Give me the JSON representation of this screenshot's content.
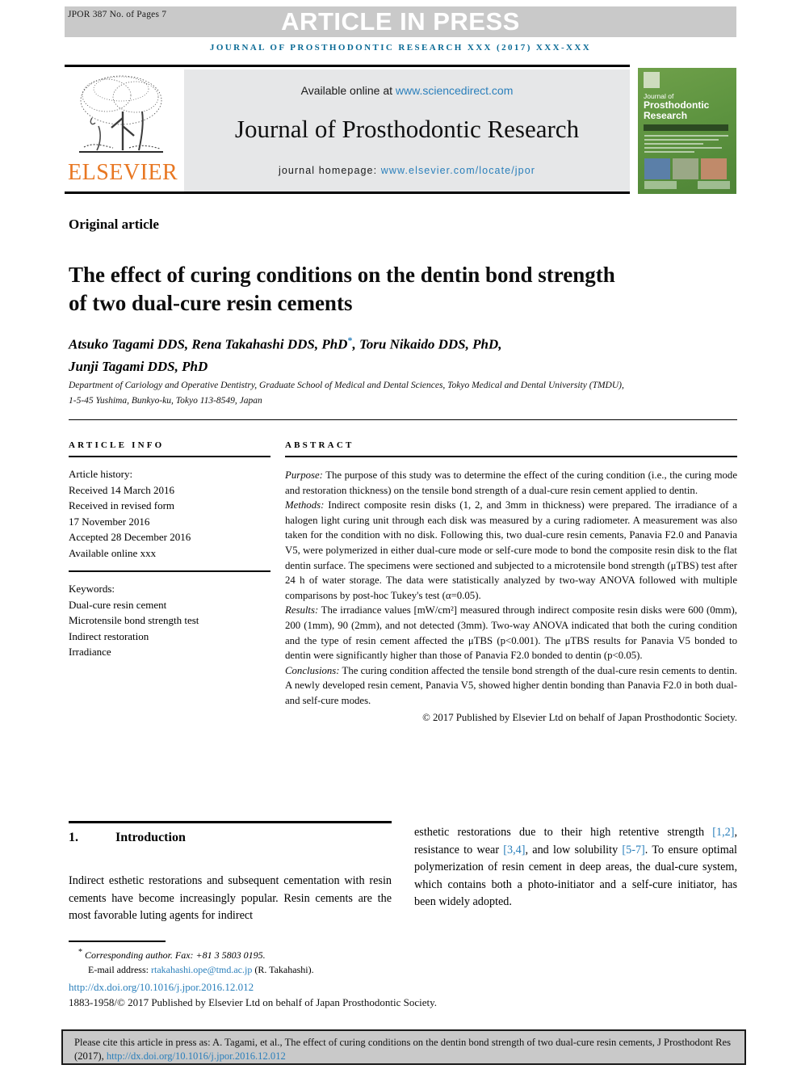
{
  "banner": {
    "jpor_code": "JPOR 387 No. of Pages 7",
    "article_in_press": "ARTICLE IN PRESS",
    "running_head": "JOURNAL OF PROSTHODONTIC RESEARCH XXX (2017) XXX-XXX",
    "accent_color": "#0a6a95",
    "banner_color": "#c9c9c9"
  },
  "masthead": {
    "available_prefix": "Available online at ",
    "sciencedirect_url": "www.sciencedirect.com",
    "journal_title": "Journal of Prosthodontic Research",
    "homepage_prefix": "journal homepage: ",
    "homepage_url": "www.elsevier.com/locate/jpor",
    "publisher": "ELSEVIER",
    "publisher_color": "#e87722",
    "link_color": "#2a7fbb",
    "cover": {
      "line1": "Journal of",
      "line2": "Prosthodontic",
      "line3": "Research"
    }
  },
  "article": {
    "type": "Original article",
    "title": "The effect of curing conditions on the dentin bond strength of two dual-cure resin cements",
    "authors_line1": "Atsuko Tagami DDS, Rena Takahashi DDS, PhD",
    "authors_corr_marker": "*",
    "authors_line1_tail": ", Toru Nikaido DDS, PhD,",
    "authors_line2": "Junji Tagami DDS, PhD",
    "affiliation": "Department of Cariology and Operative Dentistry, Graduate School of Medical and Dental Sciences, Tokyo Medical and Dental University (TMDU), 1-5-45 Yushima, Bunkyo-ku, Tokyo 113-8549, Japan"
  },
  "article_info": {
    "heading": "ARTICLE INFO",
    "history_label": "Article history:",
    "history": [
      "Received 14 March 2016",
      "Received in revised form",
      "17 November 2016",
      "Accepted 28 December 2016",
      "Available online xxx"
    ],
    "keywords_label": "Keywords:",
    "keywords": [
      "Dual-cure resin cement",
      "Microtensile bond strength test",
      "Indirect restoration",
      "Irradiance"
    ]
  },
  "abstract": {
    "heading": "ABSTRACT",
    "purpose_label": "Purpose:",
    "purpose_text": " The purpose of this study was to determine the effect of the curing condition (i.e., the curing mode and restoration thickness) on the tensile bond strength of a dual-cure resin cement applied to dentin.",
    "methods_label": "Methods:",
    "methods_text": " Indirect composite resin disks (1, 2, and 3mm in thickness) were prepared. The irradiance of a halogen light curing unit through each disk was measured by a curing radiometer. A measurement was also taken for the condition with no disk. Following this, two dual-cure resin cements, Panavia F2.0 and Panavia V5, were polymerized in either dual-cure mode or self-cure mode to bond the composite resin disk to the flat dentin surface. The specimens were sectioned and subjected to a microtensile bond strength (μTBS) test after 24 h of water storage. The data were statistically analyzed by two-way ANOVA followed with multiple comparisons by post-hoc Tukey's test (α=0.05).",
    "results_label": "Results:",
    "results_text": " The irradiance values [mW/cm²] measured through indirect composite resin disks were 600 (0mm), 200 (1mm), 90 (2mm), and not detected (3mm). Two-way ANOVA indicated that both the curing condition and the type of resin cement affected the μTBS (p<0.001). The μTBS results for Panavia V5 bonded to dentin were significantly higher than those of Panavia F2.0 bonded to dentin (p<0.05).",
    "conclusions_label": "Conclusions:",
    "conclusions_text": " The curing condition affected the tensile bond strength of the dual-cure resin cements to dentin. A newly developed resin cement, Panavia V5, showed higher dentin bonding than Panavia F2.0 in both dual- and self-cure modes.",
    "copyright": "© 2017 Published by Elsevier Ltd on behalf of Japan Prosthodontic Society."
  },
  "introduction": {
    "number": "1.",
    "heading": "Introduction",
    "left_text": "Indirect esthetic restorations and subsequent cementation with resin cements have become increasingly popular. Resin cements are the most favorable luting agents for indirect",
    "right_part1": "esthetic restorations due to their high retentive strength ",
    "right_ref1": "[1,2]",
    "right_part2": ", resistance to wear ",
    "right_ref2": "[3,4]",
    "right_part3": ", and low solubility ",
    "right_ref3": "[5-7]",
    "right_part4": ". To ensure optimal polymerization of resin cement in deep areas, the dual-cure system, which contains both a photo-initiator and a self-cure initiator, has been widely adopted."
  },
  "footnotes": {
    "corresponding": "Corresponding author. Fax: +81 3 5803 0195.",
    "email_label": "E-mail address: ",
    "email": "rtakahashi.ope@tmd.ac.jp",
    "email_suffix": " (R. Takahashi).",
    "doi": "http://dx.doi.org/10.1016/j.jpor.2016.12.012",
    "issn": "1883-1958/© 2017 Published by Elsevier Ltd on behalf of Japan Prosthodontic Society."
  },
  "cite_box": {
    "prefix": "Please cite this article in press as: A. Tagami, et al., The effect of curing conditions on the dentin bond strength of two dual-cure resin cements, J Prosthodont Res (2017), ",
    "url": "http://dx.doi.org/10.1016/j.jpor.2016.12.012"
  }
}
